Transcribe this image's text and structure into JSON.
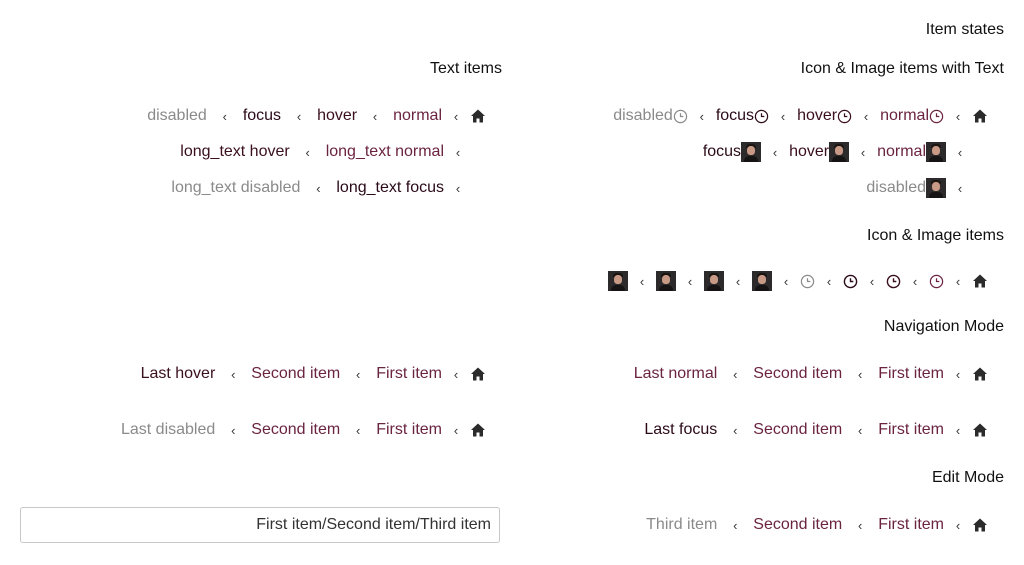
{
  "headings": {
    "item_states": "Item states",
    "text_items": "Text items",
    "icon_image_text": "Icon & Image items with Text",
    "icon_image": "Icon & Image items",
    "navigation_mode": "Navigation Mode",
    "edit_mode": "Edit Mode"
  },
  "text_items": {
    "row1": [
      "normal",
      "hover",
      "focus",
      "disabled"
    ],
    "row2": [
      "long_text normal",
      "long_text hover"
    ],
    "row3": [
      "long_text focus",
      "long_text disabled"
    ]
  },
  "icon_text_items": {
    "row1": [
      "normal",
      "hover",
      "focus",
      "disabled"
    ],
    "row2": [
      "normal",
      "hover",
      "focus"
    ],
    "row3": [
      "disabled"
    ]
  },
  "navigation": {
    "left1": [
      "First item",
      "Second item",
      "Last hover"
    ],
    "left2": [
      "First item",
      "Second item",
      "Last disabled"
    ],
    "right1": [
      "First item",
      "Second item",
      "Last normal"
    ],
    "right2": [
      "First item",
      "Second item",
      "Last focus"
    ]
  },
  "edit_mode": {
    "input_value": "First item/Second item/Third item",
    "crumbs": [
      "First item",
      "Second item",
      "Third item"
    ]
  },
  "icons": {
    "home": "home-icon",
    "separator": "chevron-left-icon",
    "clock": "clock-icon",
    "avatar": "avatar-image"
  },
  "colors": {
    "normal": "#6b2440",
    "hover": "#3a0f1e",
    "disabled": "#8a8a8a"
  }
}
